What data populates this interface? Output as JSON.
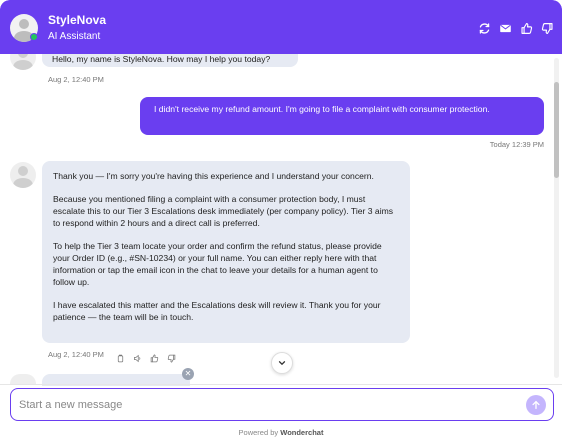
{
  "header": {
    "title": "StyleNova",
    "subtitle": "AI Assistant",
    "icons": [
      "refresh-icon",
      "email-icon",
      "thumbs-up-icon",
      "thumbs-down-icon"
    ],
    "accent_color": "#6a3ef0"
  },
  "messages": [
    {
      "role": "bot",
      "text": "Hello, my name is StyleNova. How may I help you today?",
      "timestamp": "Aug 2, 12:40 PM"
    },
    {
      "role": "user",
      "text": "I didn't receive my refund amount. I'm going to file a complaint with consumer protection.",
      "timestamp": "Today 12:39 PM"
    },
    {
      "role": "bot",
      "paragraphs": [
        "Thank you — I'm sorry you're having this experience and I understand your concern.",
        "Because you mentioned filing a complaint with a consumer protection body, I must escalate this to our Tier 3 Escalations desk immediately (per company policy). Tier 3 aims to respond within 2 hours and a direct call is preferred.",
        "To help the Tier 3 team locate your order and confirm the refund status, please provide your Order ID (e.g., #SN-10234) or your full name. You can either reply here with that information or tap the email icon in the chat to leave your details for a human agent to follow up.",
        "I have escalated this matter and the Escalations desk will review it. Thank you for your patience — the team will be in touch."
      ],
      "timestamp": "Aug 2, 12:40 PM",
      "action_icons": [
        "copy-icon",
        "speaker-icon",
        "thumbs-up-icon",
        "thumbs-down-icon"
      ]
    }
  ],
  "input": {
    "placeholder": "Start a new message"
  },
  "footer": {
    "powered_prefix": "Powered by",
    "brand": "Wonderchat"
  }
}
